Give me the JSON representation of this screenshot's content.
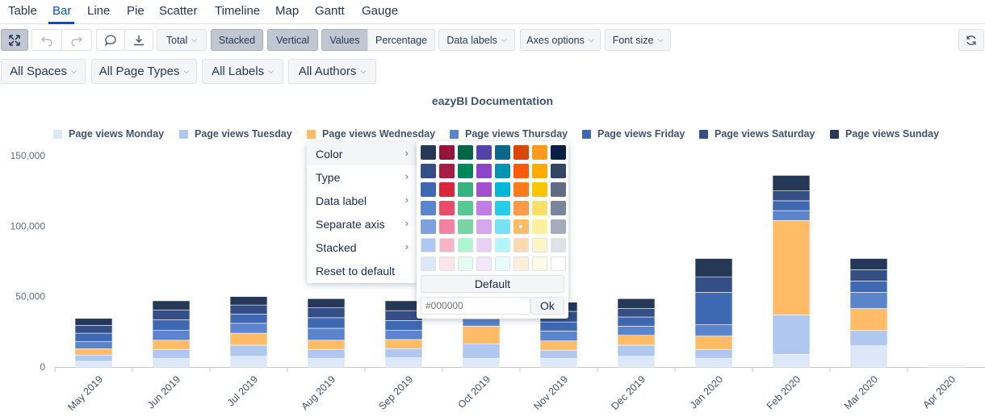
{
  "tabs": [
    "Table",
    "Bar",
    "Line",
    "Pie",
    "Scatter",
    "Timeline",
    "Map",
    "Gantt",
    "Gauge"
  ],
  "active_tab": "Bar",
  "toolbar": {
    "fullscreen_icon": "expand-icon",
    "undo_icon": "undo-icon",
    "redo_icon": "redo-icon",
    "comment_icon": "comment-icon",
    "export_icon": "download-icon",
    "total": "Total",
    "stacked": "Stacked",
    "vertical": "Vertical",
    "values": "Values",
    "percentage": "Percentage",
    "data_labels": "Data labels",
    "axes_options": "Axes options",
    "font_size": "Font size",
    "refresh_icon": "refresh-icon"
  },
  "filters": [
    "All Spaces",
    "All Page Types",
    "All Labels",
    "All Authors"
  ],
  "context_menu": {
    "items": [
      "Color",
      "Type",
      "Data label",
      "Separate axis",
      "Stacked",
      "Reset to default"
    ]
  },
  "color_picker": {
    "rows": [
      [
        "#253858",
        "#97133b",
        "#006644",
        "#5243aa",
        "#0a6787",
        "#d94709",
        "#ff991f",
        "#091e42"
      ],
      [
        "#344e86",
        "#a61e43",
        "#00875a",
        "#8b45c9",
        "#0493b3",
        "#ff5a0a",
        "#ffab00",
        "#344563"
      ],
      [
        "#3f68b2",
        "#d9243c",
        "#36b37e",
        "#a44ed0",
        "#00b8d9",
        "#ff7a1a",
        "#ffc400",
        "#5e6c84"
      ],
      [
        "#5a84cc",
        "#ea4c6b",
        "#57c793",
        "#c17ce5",
        "#23cee6",
        "#ff9b4a",
        "#ffdf6a",
        "#7a869a"
      ],
      [
        "#7ea1dd",
        "#f382a0",
        "#79d4a4",
        "#d5a8ee",
        "#79e2f2",
        "#ffbb66",
        "#fff0a0",
        "#a5adba"
      ],
      [
        "#b0c8ef",
        "#f8b4c6",
        "#abf5d1",
        "#e7cff5",
        "#b3f5ff",
        "#ffd8ad",
        "#fff5c5",
        "#dfe1e6"
      ],
      [
        "#dce7f8",
        "#fde3ea",
        "#e3fcef",
        "#f3e8fb",
        "#e6fcff",
        "#ffeed9",
        "#fffae6",
        "#ffffff"
      ]
    ],
    "selected": "#ffbb66",
    "default_label": "Default",
    "hex_placeholder": "#000000",
    "ok_label": "Ok"
  },
  "chart_data": {
    "type": "bar",
    "stacked": true,
    "title": "eazyBI Documentation",
    "legend_position": "top",
    "categories": [
      "May 2019",
      "Jun 2019",
      "Jul 2019",
      "Aug 2019",
      "Sep 2019",
      "Oct 2019",
      "Nov 2019",
      "Dec 2019",
      "Jan 2020",
      "Feb 2020",
      "Mar 2020",
      "Apr 2020"
    ],
    "ylim": [
      0,
      150000
    ],
    "yticks": [
      "0",
      "50,000",
      "100,000",
      "150,000"
    ],
    "ytick_values": [
      0,
      50000,
      100000,
      150000
    ],
    "grid": false,
    "series": [
      {
        "name": "Page views Monday",
        "color": "#dce7f8",
        "values": [
          4000,
          6000,
          7500,
          6000,
          6500,
          6000,
          6000,
          7500,
          6000,
          9000,
          15000,
          500
        ]
      },
      {
        "name": "Page views Tuesday",
        "color": "#b0c8ef",
        "values": [
          4500,
          6500,
          8000,
          6500,
          6500,
          10500,
          6000,
          8000,
          6500,
          28000,
          11000,
          500
        ]
      },
      {
        "name": "Page views Wednesday",
        "color": "#ffbb66",
        "values": [
          4500,
          6500,
          8500,
          6500,
          6500,
          12500,
          6500,
          7000,
          9500,
          67000,
          15500,
          500
        ]
      },
      {
        "name": "Page views Thursday",
        "color": "#5a84cc",
        "values": [
          5000,
          7000,
          7000,
          8500,
          6500,
          5000,
          7000,
          6500,
          8000,
          7000,
          11500,
          300
        ]
      },
      {
        "name": "Page views Friday",
        "color": "#3f68b2",
        "values": [
          6000,
          7500,
          6500,
          7500,
          7000,
          5000,
          6500,
          6500,
          23000,
          7000,
          8000,
          300
        ]
      },
      {
        "name": "Page views Saturday",
        "color": "#344e86",
        "values": [
          5500,
          7000,
          6500,
          7000,
          7000,
          4500,
          7500,
          6000,
          11000,
          7000,
          8000,
          300
        ]
      },
      {
        "name": "Page views Sunday",
        "color": "#253858",
        "values": [
          5000,
          6500,
          6000,
          6500,
          7000,
          4000,
          6500,
          7000,
          13000,
          11000,
          8000,
          400
        ]
      }
    ]
  }
}
